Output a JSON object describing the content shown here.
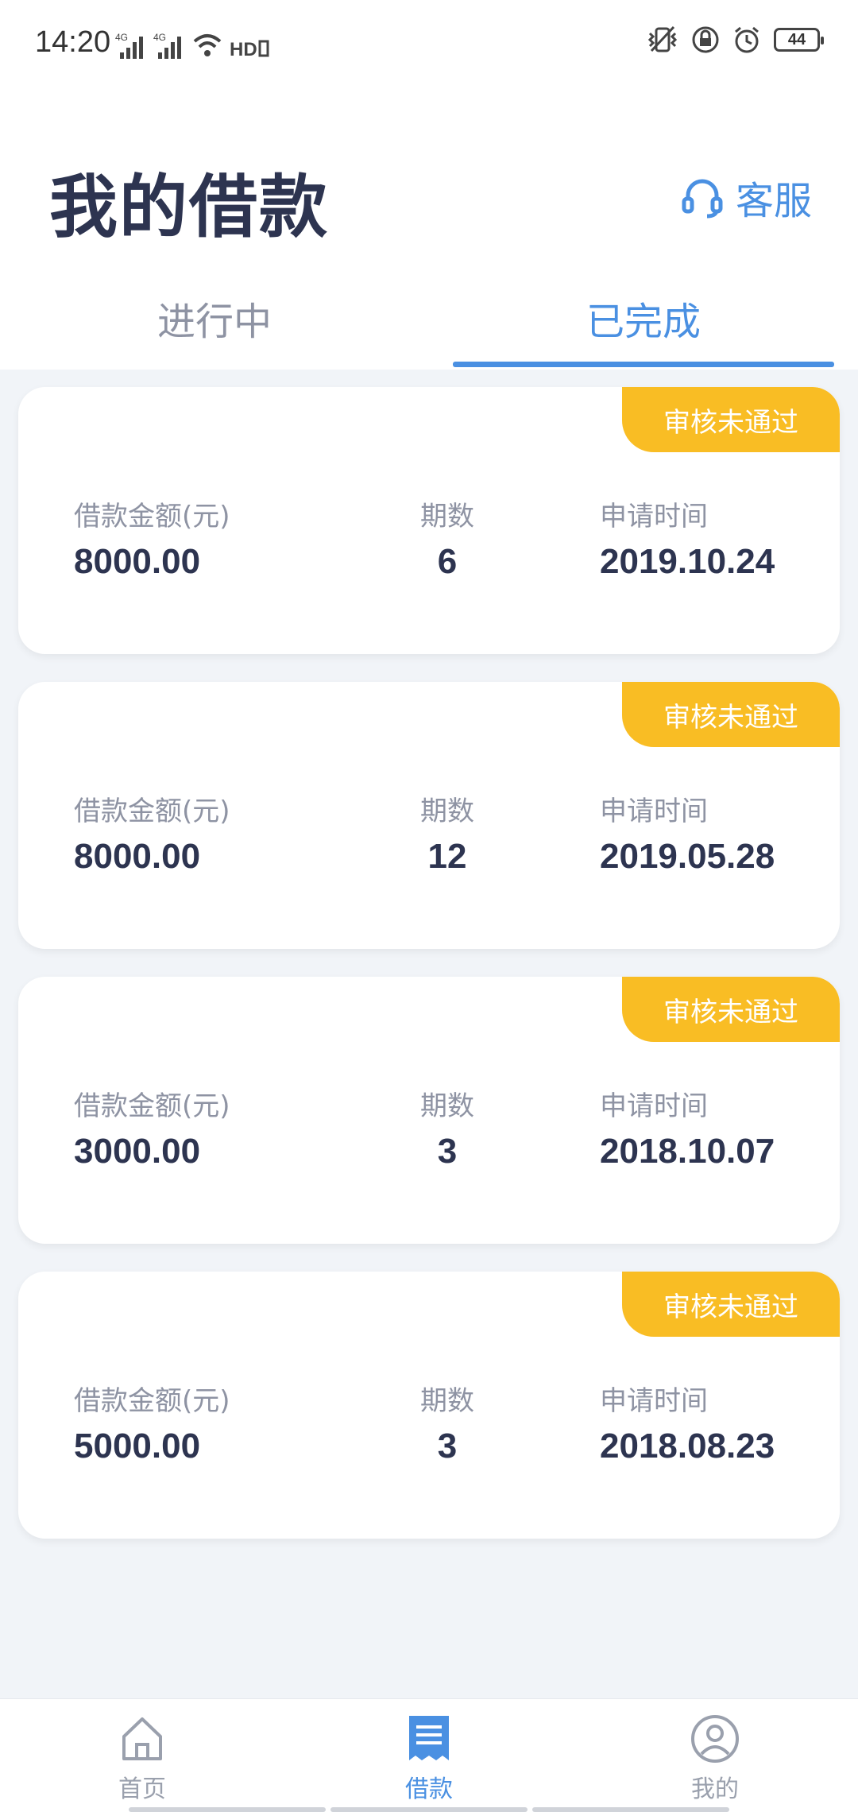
{
  "status_bar": {
    "time": "14:20",
    "signal1": "4G",
    "signal2": "4G",
    "hd": "HD",
    "battery": "44"
  },
  "header": {
    "title": "我的借款",
    "service_label": "客服",
    "accent_color": "#4a90e2"
  },
  "tabs": [
    {
      "label": "进行中",
      "active": false
    },
    {
      "label": "已完成",
      "active": true
    }
  ],
  "loans": [
    {
      "status": "审核未通过",
      "amount_label": "借款金额(元)",
      "amount": "8000.00",
      "periods_label": "期数",
      "periods": "6",
      "date_label": "申请时间",
      "date": "2019.10.24"
    },
    {
      "status": "审核未通过",
      "amount_label": "借款金额(元)",
      "amount": "8000.00",
      "periods_label": "期数",
      "periods": "12",
      "date_label": "申请时间",
      "date": "2019.05.28"
    },
    {
      "status": "审核未通过",
      "amount_label": "借款金额(元)",
      "amount": "3000.00",
      "periods_label": "期数",
      "periods": "3",
      "date_label": "申请时间",
      "date": "2018.10.07"
    },
    {
      "status": "审核未通过",
      "amount_label": "借款金额(元)",
      "amount": "5000.00",
      "periods_label": "期数",
      "periods": "3",
      "date_label": "申请时间",
      "date": "2018.08.23"
    }
  ],
  "bottom_nav": [
    {
      "label": "首页",
      "icon": "home-icon",
      "active": false
    },
    {
      "label": "借款",
      "icon": "document-icon",
      "active": true
    },
    {
      "label": "我的",
      "icon": "user-icon",
      "active": false
    }
  ],
  "colors": {
    "badge": "#f9bd24",
    "text_dark": "#2d3450",
    "text_muted": "#8e93a3"
  }
}
